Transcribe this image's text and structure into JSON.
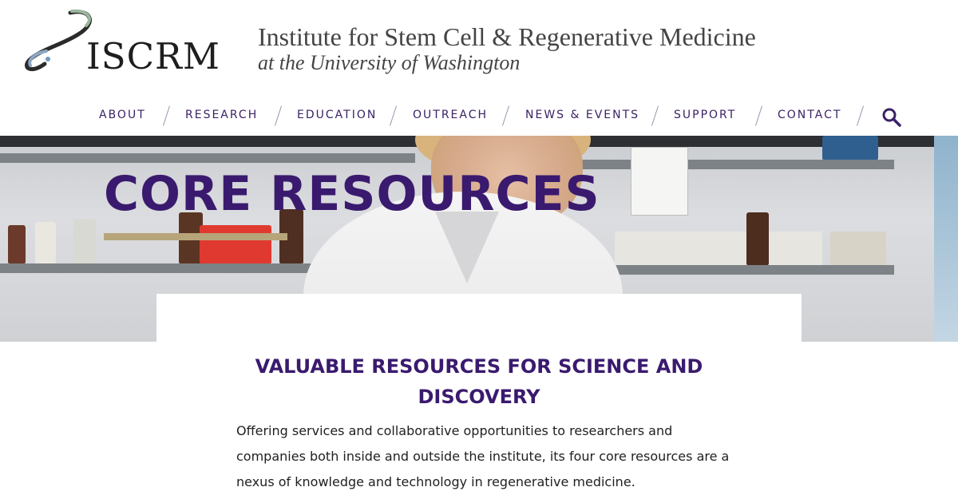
{
  "header": {
    "logo_text": "ISCRM",
    "title": "Institute for Stem Cell & Regenerative Medicine",
    "subtitle": "at the University of Washington"
  },
  "nav": {
    "items": [
      {
        "label": "ABOUT"
      },
      {
        "label": "RESEARCH"
      },
      {
        "label": "EDUCATION"
      },
      {
        "label": "OUTREACH"
      },
      {
        "label": "NEWS & EVENTS"
      },
      {
        "label": "SUPPORT"
      },
      {
        "label": "CONTACT"
      }
    ],
    "search_icon": "search-icon"
  },
  "hero": {
    "title": "CORE RESOURCES"
  },
  "content": {
    "heading": "VALUABLE RESOURCES FOR SCIENCE AND DISCOVERY",
    "body": "Offering services and collaborative opportunities to researchers and companies both inside and outside the institute, its four core resources are a nexus of knowledge and technology in regenerative medicine."
  },
  "colors": {
    "brand_purple": "#3a1a6e",
    "nav_text": "#3b2266",
    "accent_gold": "#b7a57a"
  }
}
